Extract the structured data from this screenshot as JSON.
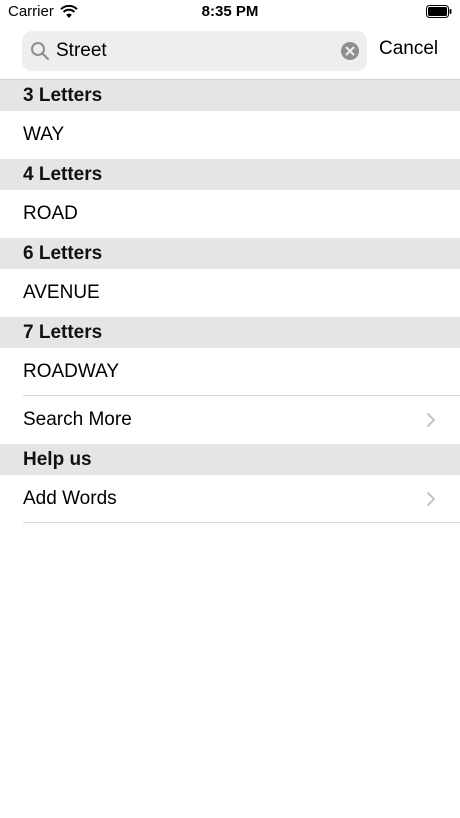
{
  "status_bar": {
    "carrier": "Carrier",
    "time": "8:35 PM"
  },
  "search": {
    "value": "Street",
    "cancel_label": "Cancel"
  },
  "sections": [
    {
      "header": "3 Letters",
      "rows": [
        "WAY"
      ]
    },
    {
      "header": "4 Letters",
      "rows": [
        "ROAD"
      ]
    },
    {
      "header": "6 Letters",
      "rows": [
        "AVENUE"
      ]
    },
    {
      "header": "7 Letters",
      "rows": [
        "ROADWAY"
      ]
    }
  ],
  "search_more_label": "Search More",
  "help": {
    "header": "Help us",
    "add_words_label": "Add Words"
  },
  "icons": {
    "search": "search-icon",
    "clear": "clear-icon",
    "chevron": "chevron-right-icon",
    "wifi": "wifi-icon",
    "battery": "battery-icon"
  },
  "colors": {
    "section_header_bg": "#e5e5e7",
    "search_field_bg": "#eeeeef"
  }
}
